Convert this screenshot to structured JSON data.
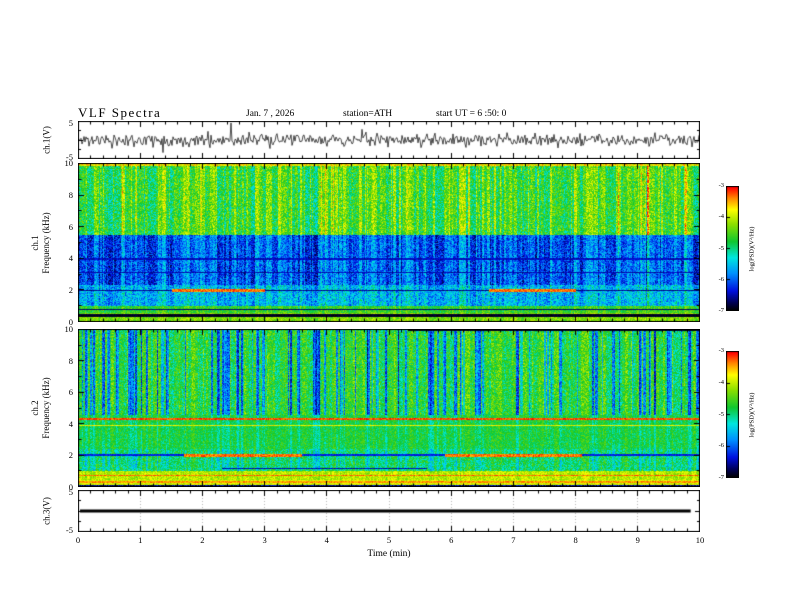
{
  "header": {
    "title": "VLF Spectra",
    "date": "Jan. 7 , 2026",
    "station": "station=ATH",
    "start_ut": "start UT = 6 :50: 0"
  },
  "x_axis": {
    "label": "Time (min)",
    "ticks": [
      "0",
      "1",
      "2",
      "3",
      "4",
      "5",
      "6",
      "7",
      "8",
      "9",
      "10"
    ],
    "range_min": [
      0,
      10
    ]
  },
  "panels": {
    "ch1_wave": {
      "ylabel": "ch.1(V)",
      "ytick_top": "5",
      "ytick_bottom": "-5",
      "ylim": [
        -5,
        5
      ]
    },
    "ch1_spec": {
      "ylabel_line1": "ch.1",
      "ylabel_line2": "Frequency (kHz)",
      "yticks": [
        "10",
        "8",
        "6",
        "4",
        "2",
        "0"
      ],
      "ylim_kHz": [
        0,
        10
      ]
    },
    "ch2_spec": {
      "ylabel_line1": "ch.2",
      "ylabel_line2": "Frequency (kHz)",
      "yticks": [
        "10",
        "8",
        "6",
        "4",
        "2",
        "0"
      ],
      "ylim_kHz": [
        0,
        10
      ]
    },
    "ch3_wave": {
      "ylabel": "ch.3(V)",
      "ytick_top": "5",
      "ytick_bottom": "-5",
      "ylim": [
        -5,
        5
      ]
    }
  },
  "colorbar": {
    "label": "log(PSD)(V²/Hz)",
    "ticks": [
      "-3",
      "-4",
      "-5",
      "-6",
      "-7"
    ],
    "range": [
      -7,
      -3
    ],
    "position": "right",
    "stops": [
      [
        0.0,
        "#000000"
      ],
      [
        0.06,
        "#000050"
      ],
      [
        0.16,
        "#0010e0"
      ],
      [
        0.3,
        "#0090ff"
      ],
      [
        0.43,
        "#00e8e0"
      ],
      [
        0.56,
        "#10c830"
      ],
      [
        0.7,
        "#8ce000"
      ],
      [
        0.82,
        "#ffff00"
      ],
      [
        0.91,
        "#ff8c00"
      ],
      [
        1.0,
        "#ff0000"
      ]
    ]
  },
  "chart_data": [
    {
      "type": "line",
      "id": "ch1-waveform",
      "ylabel": "ch.1(V)",
      "xlabel": "Time (min)",
      "xlim": [
        0,
        10
      ],
      "ylim": [
        -5,
        5
      ],
      "description": "Broadband noise waveform of channel 1: zero-mean, rms about 1 V, with dense impulsive spikes reaching roughly ±4 V over the whole 10-minute record.",
      "gen": {
        "seed": 11,
        "rms_volts": 1.0,
        "spike_prob": 0.015,
        "spike_volts": [
          1.5,
          4.2
        ]
      }
    },
    {
      "type": "heatmap",
      "id": "ch1-spectrogram",
      "ylabel": "ch.1 Frequency (kHz)",
      "xlabel": "Time (min)",
      "xlim": [
        0,
        10
      ],
      "ylim": [
        0,
        10
      ],
      "zlabel": "log(PSD)(V²/Hz)",
      "zlim": [
        -7,
        -3
      ],
      "bands": [
        {
          "f_kHz": [
            5.5,
            10.01
          ],
          "level": -4.55,
          "vstreak": 0.55,
          "drop": 0.85,
          "speckle": 0.5,
          "note": "green-yellow, strong vertical striping, orange-red flecks near 10 kHz"
        },
        {
          "f_kHz": [
            2.35,
            5.5
          ],
          "level": -6.0,
          "vstreak": 0.45,
          "drop": 0.55,
          "speckle": 0.45,
          "note": "deep blue band with cyan vertical streaks"
        },
        {
          "f_kHz": [
            1.05,
            2.35
          ],
          "level": -5.55,
          "vstreak": 0.35,
          "drop": 0.3,
          "speckle": 0.5,
          "note": "blue-cyan speckle"
        },
        {
          "f_kHz": [
            0.6,
            1.05
          ],
          "level": -4.6,
          "vstreak": 0.2,
          "drop": 0.1,
          "speckle": 0.35,
          "note": "green"
        },
        {
          "f_kHz": [
            0,
            0.6
          ],
          "level": -4.25,
          "vstreak": 0.15,
          "drop": 0,
          "speckle": 0.3,
          "note": "yellow-green base"
        }
      ],
      "hlines": [
        {
          "f_kHz": 9.93,
          "halfw_kHz": 0.08,
          "level": -3.7,
          "x_min": [
            0,
            10
          ],
          "jitter": 0.4,
          "note": "hot flecks at top edge"
        },
        {
          "f_kHz": 0.45,
          "halfw_kHz": 0.09,
          "level": -6.9,
          "x_min": [
            0,
            10
          ],
          "jitter": 0.1,
          "note": "black line"
        },
        {
          "f_kHz": 0.8,
          "halfw_kHz": 0.04,
          "level": -6.7,
          "x_min": [
            0,
            10
          ],
          "jitter": 0.1
        },
        {
          "f_kHz": 3.15,
          "halfw_kHz": 0.04,
          "level": -6.5,
          "x_min": [
            0,
            10
          ],
          "jitter": 0.15
        },
        {
          "f_kHz": 4.0,
          "halfw_kHz": 0.04,
          "level": -6.45,
          "x_min": [
            0,
            10
          ],
          "jitter": 0.15
        },
        {
          "f_kHz": 2.0,
          "halfw_kHz": 0.05,
          "level": -6.6,
          "x_min": [
            0,
            10
          ],
          "jitter": 0.15,
          "note": "dark line"
        },
        {
          "f_kHz": 2.0,
          "halfw_kHz": 0.09,
          "level": -3.3,
          "x_min": [
            1.5,
            3.0
          ],
          "jitter": 0.25,
          "note": "red segment"
        },
        {
          "f_kHz": 2.0,
          "halfw_kHz": 0.09,
          "level": -3.3,
          "x_min": [
            6.6,
            8.0
          ],
          "jitter": 0.25,
          "note": "red segment"
        }
      ],
      "gen": {
        "seed": 22,
        "drop_prob": 0.05,
        "drop_run": 2
      }
    },
    {
      "type": "heatmap",
      "id": "ch2-spectrogram",
      "ylabel": "ch.2 Frequency (kHz)",
      "xlabel": "Time (min)",
      "xlim": [
        0,
        10
      ],
      "ylim": [
        0,
        10
      ],
      "zlabel": "log(PSD)(V²/Hz)",
      "zlim": [
        -7,
        -3
      ],
      "bands": [
        {
          "f_kHz": [
            4.6,
            10.01
          ],
          "level": -4.7,
          "vstreak": 0.35,
          "drop": -1.5,
          "speckle": 0.45,
          "note": "green with many deep-blue vertical dropouts"
        },
        {
          "f_kHz": [
            2.45,
            4.6
          ],
          "level": -4.75,
          "vstreak": 0.15,
          "drop": -0.35,
          "speckle": 0.3,
          "note": "fairly uniform green"
        },
        {
          "f_kHz": [
            1.05,
            2.45
          ],
          "level": -4.9,
          "vstreak": 0.2,
          "drop": -0.5,
          "speckle": 0.45,
          "note": "green-cyan speckle"
        },
        {
          "f_kHz": [
            0.5,
            1.05
          ],
          "level": -4.0,
          "vstreak": 0.1,
          "drop": -0.15,
          "speckle": 0.3,
          "note": "yellow band"
        },
        {
          "f_kHz": [
            0.18,
            0.5
          ],
          "level": -3.9,
          "vstreak": 0.05,
          "drop": 0,
          "speckle": 0.25,
          "note": "yellow-orange band"
        },
        {
          "f_kHz": [
            0,
            0.18
          ],
          "level": -6.6,
          "vstreak": 0,
          "drop": 0,
          "speckle": 0.4,
          "note": "dark base strip"
        }
      ],
      "hlines": [
        {
          "f_kHz": 9.95,
          "halfw_kHz": 0.07,
          "level": -6.9,
          "x_min": [
            5.3,
            10
          ],
          "jitter": 0.1,
          "note": "black segment at top edge"
        },
        {
          "f_kHz": 4.35,
          "halfw_kHz": 0.05,
          "level": -3.2,
          "x_min": [
            0,
            10
          ],
          "jitter": 0.2,
          "note": "red line"
        },
        {
          "f_kHz": 3.9,
          "halfw_kHz": 0.03,
          "level": -3.8,
          "x_min": [
            0,
            10
          ],
          "jitter": 0.25
        },
        {
          "f_kHz": 2.05,
          "halfw_kHz": 0.05,
          "level": -6.3,
          "x_min": [
            0,
            10
          ],
          "jitter": 0.15,
          "note": "dark line"
        },
        {
          "f_kHz": 2.05,
          "halfw_kHz": 0.1,
          "level": -3.3,
          "x_min": [
            1.7,
            3.6
          ],
          "jitter": 0.25,
          "note": "red segment"
        },
        {
          "f_kHz": 2.05,
          "halfw_kHz": 0.1,
          "level": -3.3,
          "x_min": [
            5.9,
            8.1
          ],
          "jitter": 0.25,
          "note": "red segment"
        },
        {
          "f_kHz": 1.2,
          "halfw_kHz": 0.04,
          "level": -6.5,
          "x_min": [
            2.3,
            5.6
          ],
          "jitter": 0.15
        },
        {
          "f_kHz": 0.75,
          "halfw_kHz": 0.04,
          "level": -3.3,
          "x_min": [
            0,
            10
          ],
          "jitter": 0.2,
          "note": "red line"
        },
        {
          "f_kHz": 0.35,
          "halfw_kHz": 0.05,
          "level": -3.4,
          "x_min": [
            0,
            10
          ],
          "jitter": 0.2,
          "note": "red line"
        },
        {
          "f_kHz": 0.05,
          "halfw_kHz": 0.04,
          "level": -3.5,
          "x_min": [
            0,
            10
          ],
          "jitter": 0.3,
          "note": "red flecks at bottom edge"
        }
      ],
      "gen": {
        "seed": 33,
        "drop_prob": 0.13,
        "drop_run": 3
      }
    },
    {
      "type": "line",
      "id": "ch3-waveform",
      "ylabel": "ch.3(V)",
      "xlabel": "Time (min)",
      "xlim": [
        0,
        10
      ],
      "ylim": [
        -5,
        5
      ],
      "description": "Channel 3 is flat: constant 0 V drawn as a thick black line across nearly the full record.",
      "x": [
        0,
        9.85
      ],
      "y": [
        0,
        0
      ]
    }
  ]
}
